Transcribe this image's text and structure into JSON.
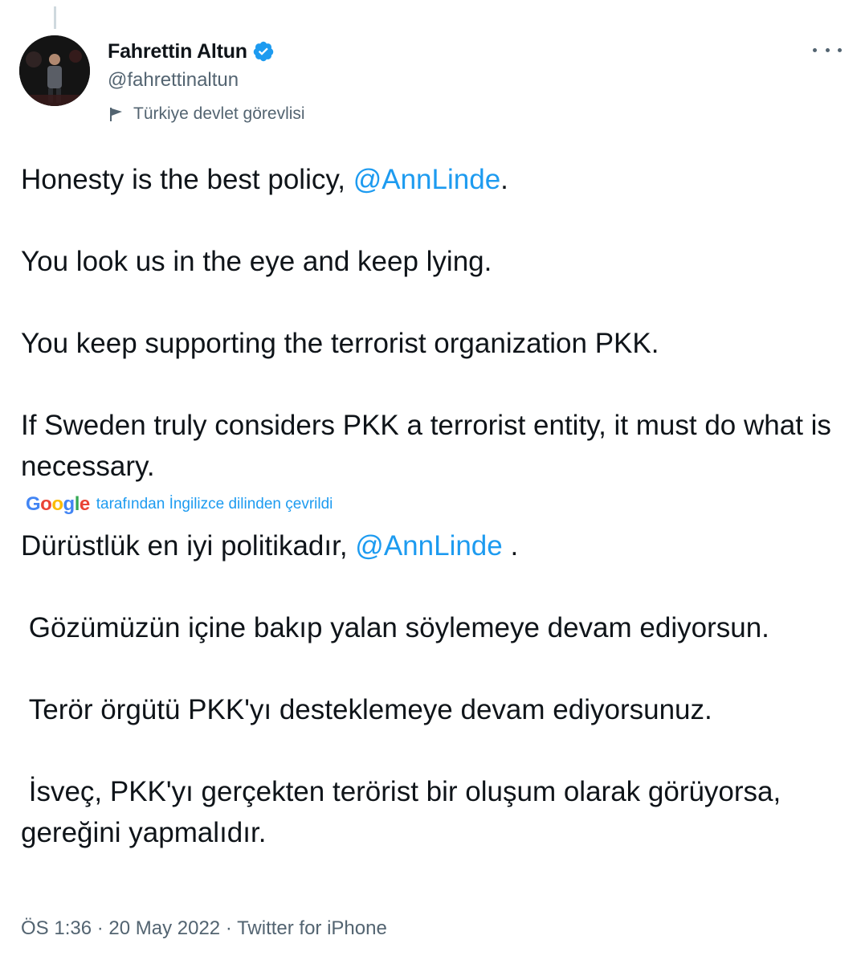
{
  "author": {
    "name": "Fahrettin Altun",
    "handle": "@fahrettinaltun",
    "label": "Türkiye devlet görevlisi"
  },
  "tweet": {
    "lines": {
      "p1_prefix": "Honesty is the best policy, ",
      "p1_mention": "@AnnLinde",
      "p1_suffix": ".",
      "p2": "You look us in the eye and keep lying.",
      "p3": "You keep supporting the terrorist organization PKK.",
      "p4": "If Sweden truly considers PKK a terrorist entity, it must do what is necessary."
    },
    "translation_note": "tarafından İngilizce dilinden çevrildi",
    "translated": {
      "p1_prefix": "Dürüstlük en iyi politikadır, ",
      "p1_mention": "@AnnLinde",
      "p1_suffix": " .",
      "p2": " Gözümüzün içine bakıp yalan söylemeye devam ediyorsun.",
      "p3": " Terör örgütü PKK'yı desteklemeye devam ediyorsunuz.",
      "p4": " İsveç, PKK'yı gerçekten terörist bir oluşum olarak görüyorsa, gereğini yapmalıdır."
    }
  },
  "meta": {
    "time": "ÖS 1:36",
    "separator": " · ",
    "date": "20 May 2022",
    "source": "Twitter for iPhone"
  },
  "google_logo": {
    "G": "G",
    "o1": "o",
    "o2": "o",
    "g": "g",
    "l": "l",
    "e": "e"
  },
  "colors": {
    "link": "#1d9bf0",
    "text": "#0f1419",
    "secondary": "#536471"
  },
  "icons": {
    "verified": "verified-badge-icon",
    "label": "flag-icon",
    "more": "more-options-icon"
  }
}
